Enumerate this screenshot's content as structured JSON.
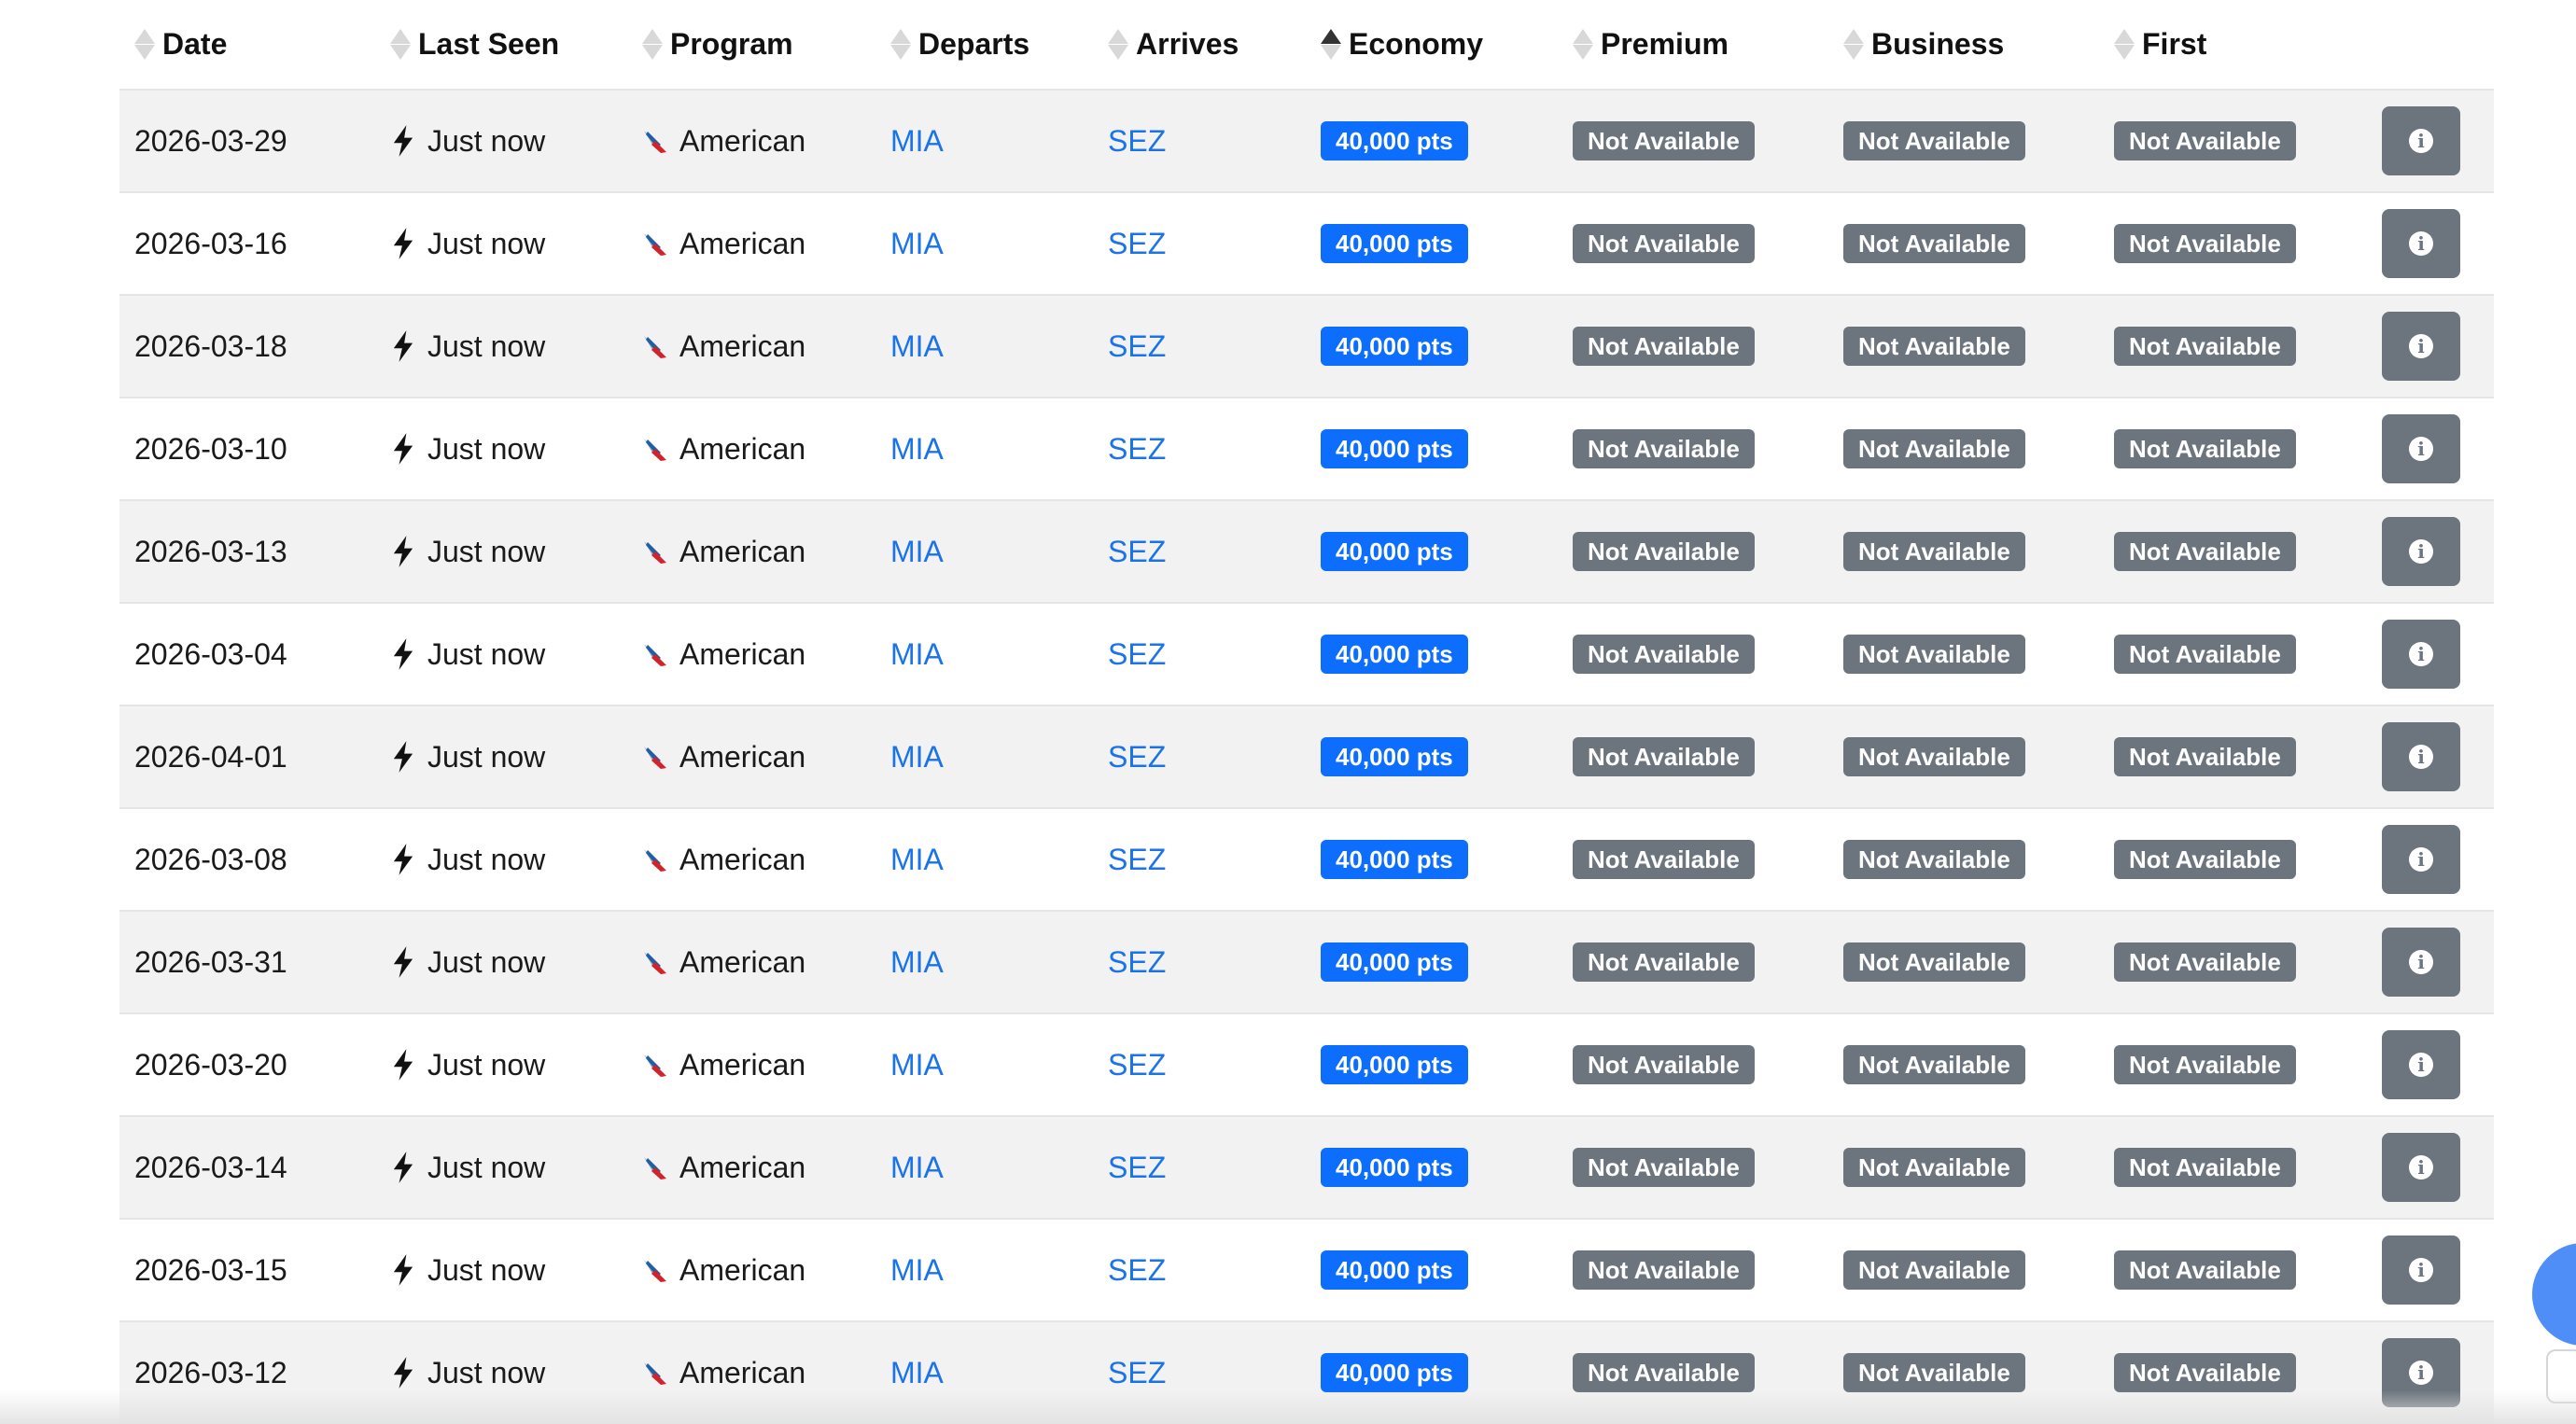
{
  "table": {
    "columns": [
      {
        "key": "date",
        "label": "Date",
        "sort": "none"
      },
      {
        "key": "last_seen",
        "label": "Last Seen",
        "sort": "none"
      },
      {
        "key": "program",
        "label": "Program",
        "sort": "none"
      },
      {
        "key": "departs",
        "label": "Departs",
        "sort": "none"
      },
      {
        "key": "arrives",
        "label": "Arrives",
        "sort": "none"
      },
      {
        "key": "economy",
        "label": "Economy",
        "sort": "asc"
      },
      {
        "key": "premium",
        "label": "Premium",
        "sort": "none"
      },
      {
        "key": "business",
        "label": "Business",
        "sort": "none"
      },
      {
        "key": "first",
        "label": "First",
        "sort": "none"
      }
    ],
    "rows": [
      {
        "date": "2026-03-29",
        "last_seen": "Just now",
        "program": "American",
        "departs": "MIA",
        "arrives": "SEZ",
        "economy": "40,000 pts",
        "premium": "Not Available",
        "business": "Not Available",
        "first": "Not Available"
      },
      {
        "date": "2026-03-16",
        "last_seen": "Just now",
        "program": "American",
        "departs": "MIA",
        "arrives": "SEZ",
        "economy": "40,000 pts",
        "premium": "Not Available",
        "business": "Not Available",
        "first": "Not Available"
      },
      {
        "date": "2026-03-18",
        "last_seen": "Just now",
        "program": "American",
        "departs": "MIA",
        "arrives": "SEZ",
        "economy": "40,000 pts",
        "premium": "Not Available",
        "business": "Not Available",
        "first": "Not Available"
      },
      {
        "date": "2026-03-10",
        "last_seen": "Just now",
        "program": "American",
        "departs": "MIA",
        "arrives": "SEZ",
        "economy": "40,000 pts",
        "premium": "Not Available",
        "business": "Not Available",
        "first": "Not Available"
      },
      {
        "date": "2026-03-13",
        "last_seen": "Just now",
        "program": "American",
        "departs": "MIA",
        "arrives": "SEZ",
        "economy": "40,000 pts",
        "premium": "Not Available",
        "business": "Not Available",
        "first": "Not Available"
      },
      {
        "date": "2026-03-04",
        "last_seen": "Just now",
        "program": "American",
        "departs": "MIA",
        "arrives": "SEZ",
        "economy": "40,000 pts",
        "premium": "Not Available",
        "business": "Not Available",
        "first": "Not Available"
      },
      {
        "date": "2026-04-01",
        "last_seen": "Just now",
        "program": "American",
        "departs": "MIA",
        "arrives": "SEZ",
        "economy": "40,000 pts",
        "premium": "Not Available",
        "business": "Not Available",
        "first": "Not Available"
      },
      {
        "date": "2026-03-08",
        "last_seen": "Just now",
        "program": "American",
        "departs": "MIA",
        "arrives": "SEZ",
        "economy": "40,000 pts",
        "premium": "Not Available",
        "business": "Not Available",
        "first": "Not Available"
      },
      {
        "date": "2026-03-31",
        "last_seen": "Just now",
        "program": "American",
        "departs": "MIA",
        "arrives": "SEZ",
        "economy": "40,000 pts",
        "premium": "Not Available",
        "business": "Not Available",
        "first": "Not Available"
      },
      {
        "date": "2026-03-20",
        "last_seen": "Just now",
        "program": "American",
        "departs": "MIA",
        "arrives": "SEZ",
        "economy": "40,000 pts",
        "premium": "Not Available",
        "business": "Not Available",
        "first": "Not Available"
      },
      {
        "date": "2026-03-14",
        "last_seen": "Just now",
        "program": "American",
        "departs": "MIA",
        "arrives": "SEZ",
        "economy": "40,000 pts",
        "premium": "Not Available",
        "business": "Not Available",
        "first": "Not Available"
      },
      {
        "date": "2026-03-15",
        "last_seen": "Just now",
        "program": "American",
        "departs": "MIA",
        "arrives": "SEZ",
        "economy": "40,000 pts",
        "premium": "Not Available",
        "business": "Not Available",
        "first": "Not Available"
      },
      {
        "date": "2026-03-12",
        "last_seen": "Just now",
        "program": "American",
        "departs": "MIA",
        "arrives": "SEZ",
        "economy": "40,000 pts",
        "premium": "Not Available",
        "business": "Not Available",
        "first": "Not Available"
      }
    ]
  },
  "icons": {
    "last_seen": "lightning-bolt-icon",
    "program": "american-airlines-logo-icon",
    "details": "info-icon",
    "sort": "sort-arrows-icon"
  },
  "colors": {
    "available_badge": "#0d6efd",
    "unavailable_badge": "#6c757d",
    "airport_link": "#1a73e8",
    "row_stripe": "#f2f2f2",
    "chat_widget": "#4f8ef7"
  }
}
